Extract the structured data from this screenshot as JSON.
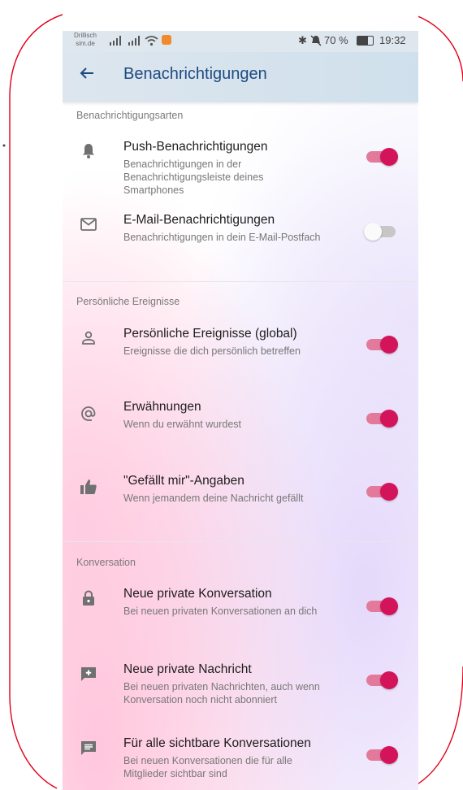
{
  "status_bar": {
    "carrier_line1": "Drillisch",
    "carrier_line2": "sim.de",
    "battery": "70 %",
    "time": "19:32"
  },
  "app_bar": {
    "title": "Benachrichtigungen"
  },
  "sections": [
    {
      "title": "Benachrichtigungsarten"
    },
    {
      "title": "Persönliche Ereignisse"
    },
    {
      "title": "Konversation"
    }
  ],
  "items": [
    {
      "icon": "bell-icon",
      "title": "Push-Benachrichtigungen",
      "subtitle": "Benachrichtigungen in der Benachrichtigungsleiste deines Smartphones",
      "enabled": true
    },
    {
      "icon": "mail-icon",
      "title": "E-Mail-Benachrichtigungen",
      "subtitle": "Benachrichtigungen in dein E-Mail-Postfach",
      "enabled": false
    },
    {
      "icon": "person-icon",
      "title": "Persönliche Ereignisse (global)",
      "subtitle": "Ereignisse die dich persönlich betreffen",
      "enabled": true
    },
    {
      "icon": "at-icon",
      "title": "Erwähnungen",
      "subtitle": "Wenn du erwähnt wurdest",
      "enabled": true
    },
    {
      "icon": "thumbs-up-icon",
      "title": "\"Gefällt mir\"-Angaben",
      "subtitle": "Wenn jemandem deine Nachricht gefällt",
      "enabled": true
    },
    {
      "icon": "lock-icon",
      "title": "Neue private Konversation",
      "subtitle": "Bei neuen privaten Konversationen an dich",
      "enabled": true
    },
    {
      "icon": "add-message-icon",
      "title": "Neue private Nachricht",
      "subtitle": "Bei neuen privaten Nachrichten, auch wenn Konversation noch nicht abonniert",
      "enabled": true
    },
    {
      "icon": "message-icon",
      "title": "Für alle sichtbare Konversationen",
      "subtitle": "Bei neuen Konversationen die für alle Mitglieder sichtbar sind",
      "enabled": true
    }
  ],
  "colors": {
    "accent": "#d3145a",
    "accent_track": "#e37a9c",
    "title": "#1e4a82",
    "frame": "#e0001a"
  }
}
